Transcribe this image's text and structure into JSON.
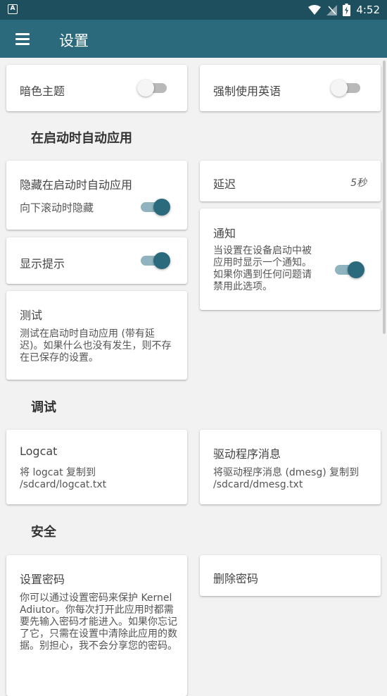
{
  "status_bar": {
    "time": "4:52",
    "app_icon_letter": "A"
  },
  "app_bar": {
    "title": "设置"
  },
  "cards": {
    "dark_theme": {
      "label": "暗色主题"
    },
    "force_english": {
      "label": "强制使用英语"
    },
    "hide_on_boot": {
      "title": "隐藏在启动时自动应用",
      "sub": "向下滚动时隐藏"
    },
    "delay": {
      "label": "延迟",
      "value": "5秒"
    },
    "notify": {
      "title": "通知",
      "desc": "当设置在设备启动中被应用时显示一个通知。如果你遇到任何问题请禁用此选项。"
    },
    "show_tips": {
      "label": "显示提示"
    },
    "test": {
      "title": "测试",
      "desc": "测试在启动时自动应用 (带有延迟)。如果什么也没有发生，则不存在已保存的设置。"
    },
    "logcat": {
      "title": "Logcat",
      "desc": "将 logcat 复制到 /sdcard/logcat.txt"
    },
    "dmesg": {
      "title": "驱动程序消息",
      "desc": "将驱动程序消息 (dmesg) 复制到 /sdcard/dmesg.txt"
    },
    "set_password": {
      "title": "设置密码",
      "desc": "你可以通过设置密码来保护 Kernel Adiutor。你每次打开此应用时都需要先输入密码才能进入。如果你忘记了它，只需在设置中清除此应用的数据。别担心，我不会分享您的密码。"
    },
    "delete_password": {
      "label": "删除密码"
    }
  },
  "sections": {
    "apply_on_boot": "在启动时自动应用",
    "debug": "调试",
    "security": "安全"
  },
  "toggles": {
    "dark_theme": false,
    "force_english": false,
    "hide_on_scroll": true,
    "show_tips": true,
    "notify": true
  },
  "colors": {
    "accent": "#2b6a7c",
    "status_bar": "#1e4f5e",
    "background": "#f2f2f2"
  },
  "icons": [
    "menu-icon",
    "wifi-icon",
    "signal-icon",
    "battery-icon"
  ]
}
